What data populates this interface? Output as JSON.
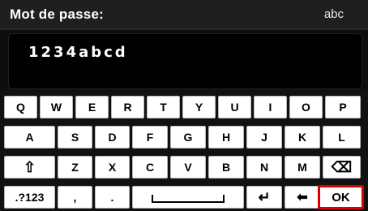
{
  "header": {
    "title": "Mot de passe:",
    "mode": "abc"
  },
  "field": {
    "value": "1234abcd"
  },
  "keyboard": {
    "row1": [
      "Q",
      "W",
      "E",
      "R",
      "T",
      "Y",
      "U",
      "I",
      "O",
      "P"
    ],
    "row2": [
      "A",
      "S",
      "D",
      "F",
      "G",
      "H",
      "J",
      "K",
      "L"
    ],
    "row3": {
      "shift": "⇧",
      "letters": [
        "Z",
        "X",
        "C",
        "V",
        "B",
        "N",
        "M"
      ],
      "backspace": "⌫"
    },
    "row4": {
      "symbols": ".?123",
      "comma": ",",
      "period": ".",
      "enter": "↵",
      "back": "⬅",
      "ok": "OK"
    }
  },
  "colors": {
    "selection_outline": "#d90000",
    "key_bg": "#ffffff",
    "header_bg": "#1f1f1f"
  }
}
